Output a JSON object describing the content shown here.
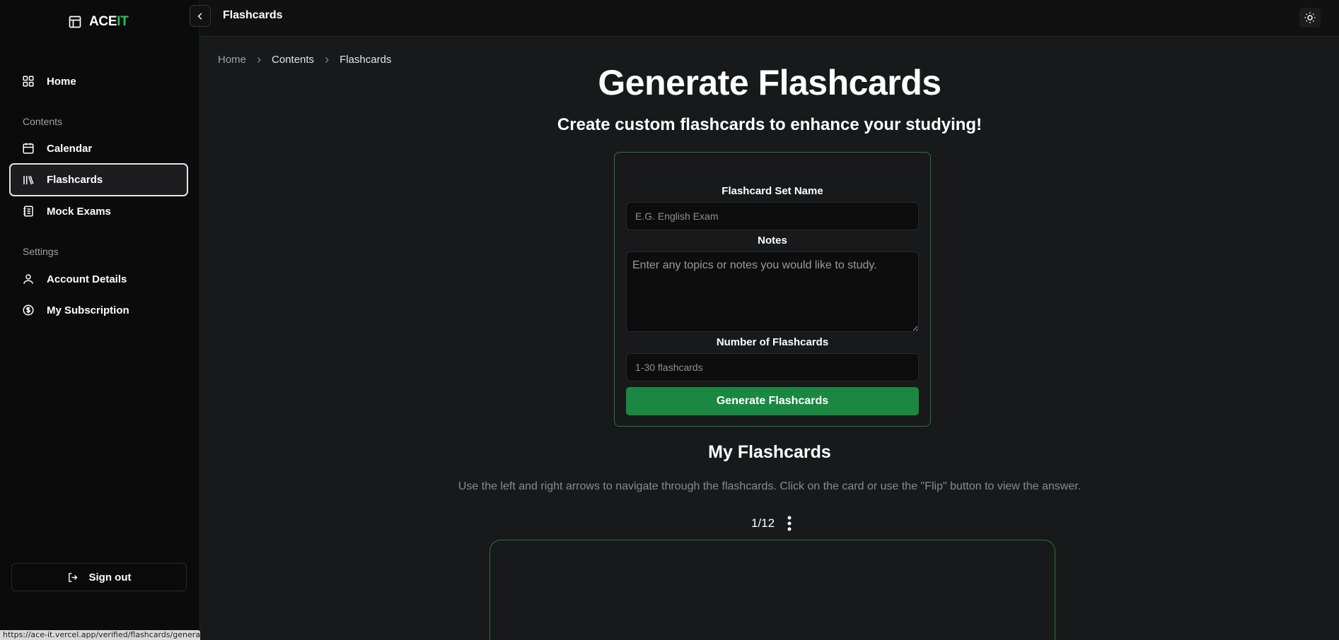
{
  "app": {
    "name_main": "ACE",
    "name_accent": "IT"
  },
  "sidebar": {
    "home": "Home",
    "contents_heading": "Contents",
    "calendar": "Calendar",
    "flashcards": "Flashcards",
    "mock_exams": "Mock Exams",
    "settings_heading": "Settings",
    "account_details": "Account Details",
    "my_subscription": "My Subscription",
    "sign_out": "Sign out"
  },
  "topbar": {
    "title": "Flashcards"
  },
  "breadcrumb": {
    "home": "Home",
    "contents": "Contents",
    "current": "Flashcards"
  },
  "main": {
    "title": "Generate Flashcards",
    "subtitle": "Create custom flashcards to enhance your studying!"
  },
  "form": {
    "set_name_label": "Flashcard Set Name",
    "set_name_placeholder": "E.G. English Exam",
    "notes_label": "Notes",
    "notes_placeholder": "Enter any topics or notes you would like to study.",
    "count_label": "Number of Flashcards",
    "count_placeholder": "1-30 flashcards",
    "submit_label": "Generate Flashcards"
  },
  "my_flashcards": {
    "title": "My Flashcards",
    "description": "Use the left and right arrows to navigate through the flashcards. Click on the card or use the \"Flip\" button to view the answer.",
    "counter": "1/12"
  },
  "status_bar": {
    "url": "https://ace-it.vercel.app/verified/flashcards/generate"
  },
  "colors": {
    "accent": "#22c55e",
    "button": "#1a8840",
    "card_border": "#1f7a3d"
  }
}
